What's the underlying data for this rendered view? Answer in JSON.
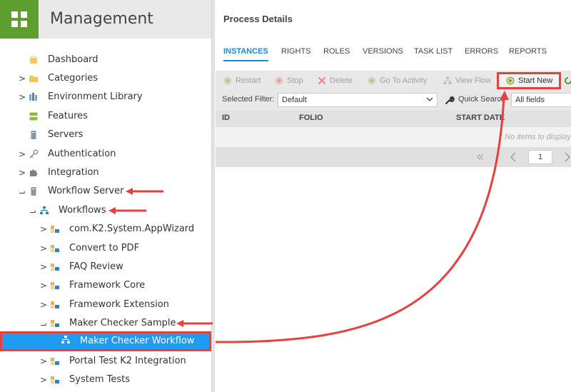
{
  "sidebar": {
    "title": "Management",
    "items": [
      {
        "label": "Dashboard",
        "icon": "dashboard-icon",
        "expander": ""
      },
      {
        "label": "Categories",
        "icon": "folder-icon",
        "expander": ">"
      },
      {
        "label": "Environment Library",
        "icon": "library-icon",
        "expander": ">"
      },
      {
        "label": "Features",
        "icon": "features-icon",
        "expander": ""
      },
      {
        "label": "Servers",
        "icon": "server-icon",
        "expander": ""
      },
      {
        "label": "Authentication",
        "icon": "key-icon",
        "expander": ">"
      },
      {
        "label": "Integration",
        "icon": "puzzle-icon",
        "expander": ">"
      },
      {
        "label": "Workflow Server",
        "icon": "server-icon",
        "expander": "⌐"
      },
      {
        "label": "Workflows",
        "icon": "workflow-icon",
        "expander": "⌐"
      },
      {
        "label": "com.K2.System.AppWizard",
        "icon": "category-icon",
        "expander": ">"
      },
      {
        "label": "Convert to PDF",
        "icon": "category-icon",
        "expander": ">"
      },
      {
        "label": "FAQ Review",
        "icon": "category-icon",
        "expander": ">"
      },
      {
        "label": "Framework Core",
        "icon": "category-icon",
        "expander": ">"
      },
      {
        "label": "Framework Extension",
        "icon": "category-icon",
        "expander": ">"
      },
      {
        "label": "Maker Checker Sample",
        "icon": "category-icon",
        "expander": "⌐"
      },
      {
        "label": "Maker Checker Workflow",
        "icon": "workflow-icon",
        "expander": ""
      },
      {
        "label": "Portal Test K2 Integration",
        "icon": "category-icon",
        "expander": ">"
      },
      {
        "label": "System Tests",
        "icon": "category-icon",
        "expander": ">"
      }
    ]
  },
  "main": {
    "title": "Process Details",
    "tabs": [
      "INSTANCES",
      "RIGHTS",
      "ROLES",
      "VERSIONS",
      "TASK LIST",
      "ERRORS",
      "REPORTS"
    ],
    "active_tab": "INSTANCES",
    "toolbar": {
      "restart": "Restart",
      "stop": "Stop",
      "delete": "Delete",
      "go_to_activity": "Go To Activity",
      "view_flow": "View Flow",
      "start_new": "Start New"
    },
    "filter": {
      "label": "Selected Filter:",
      "value": "Default",
      "quick_search_label": "Quick Search",
      "quick_search_value": "All fields"
    },
    "grid": {
      "columns": [
        "ID",
        "FOLIO",
        "START DATE"
      ],
      "empty_message": "No items to display"
    },
    "pager": {
      "page": "1"
    }
  },
  "colors": {
    "accent": "#1a8ad8",
    "selected_row": "#1e9cf0",
    "annotation_red": "#e8403c",
    "logo_green": "#5e9e2f"
  }
}
